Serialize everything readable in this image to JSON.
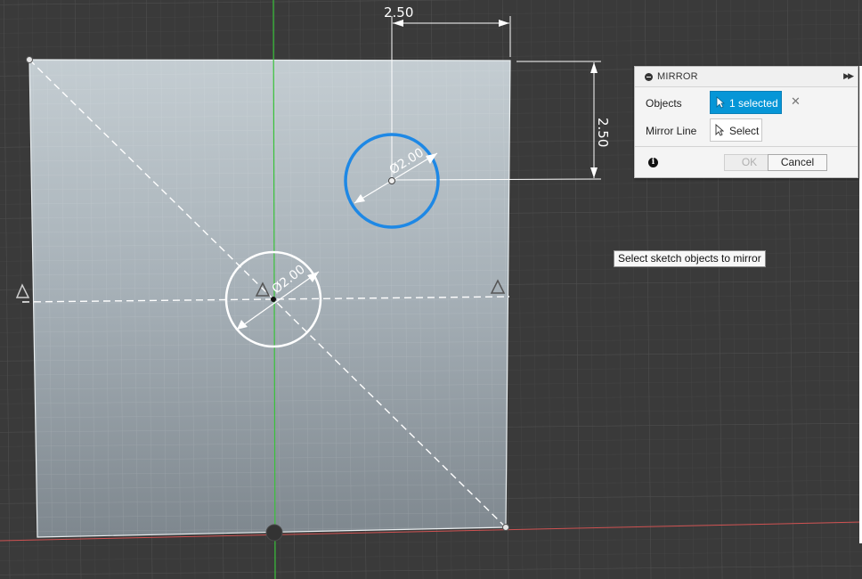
{
  "sketch": {
    "horizontal_dimension": "2.50",
    "vertical_dimension": "2.50",
    "selected_circle_diameter": "Ø2.00",
    "center_circle_diameter": "Ø2.00"
  },
  "colors": {
    "canvas_background": "#3a3a3a",
    "selection_blue": "#1e88e5",
    "panel_accent": "#0696d7",
    "y_axis": "#39c23a",
    "x_axis": "#d05252"
  },
  "mirror_panel": {
    "title": "MIRROR",
    "objects_label": "Objects",
    "objects_value": "1 selected",
    "mirror_line_label": "Mirror Line",
    "mirror_line_value": "Select",
    "ok_label": "OK",
    "cancel_label": "Cancel",
    "icons": {
      "collapse": "collapse-icon",
      "expand": "expand-icon",
      "clear": "clear-icon",
      "info": "info-icon",
      "cursor": "cursor-arrow-icon"
    }
  },
  "tooltip": {
    "text": "Select sketch objects to mirror"
  }
}
